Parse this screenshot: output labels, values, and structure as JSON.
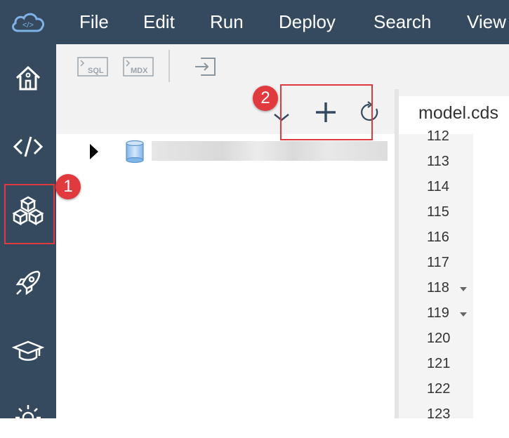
{
  "menu": {
    "items": [
      "File",
      "Edit",
      "Run",
      "Deploy",
      "Search",
      "View"
    ]
  },
  "sidebar": {
    "items": [
      {
        "icon": "home-icon"
      },
      {
        "icon": "code-icon"
      },
      {
        "icon": "database-explorer-icon"
      },
      {
        "icon": "rocket-icon"
      },
      {
        "icon": "graduation-cap-icon"
      },
      {
        "icon": "gear-icon"
      }
    ]
  },
  "toolbar": {
    "sql_label": "SQL",
    "mdx_label": "MDX"
  },
  "editor": {
    "tab_label": "model.cds",
    "line_numbers": [
      "112",
      "113",
      "114",
      "115",
      "116",
      "117",
      "118",
      "119",
      "120",
      "121",
      "122",
      "123"
    ],
    "foldable_lines": [
      "118",
      "119"
    ]
  },
  "callouts": {
    "badge_1": "1",
    "badge_2": "2",
    "color": "#e0393e"
  },
  "colors": {
    "shell": "#354a5f",
    "panel": "#f2f2f2"
  }
}
